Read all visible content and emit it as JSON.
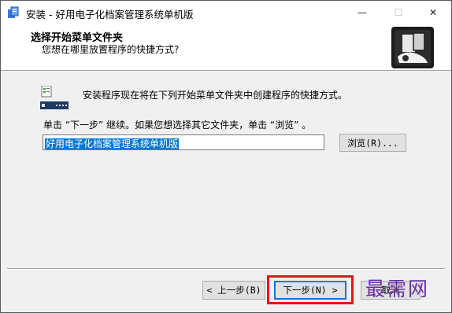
{
  "window": {
    "title": "安装 - 好用电子化档案管理系统单机版",
    "controls": {
      "minimize": "—",
      "maximize": "☐",
      "close": "✕"
    }
  },
  "header": {
    "title": "选择开始菜单文件夹",
    "subtitle": "您想在哪里放置程序的快捷方式?"
  },
  "content": {
    "info_text": "安装程序现在将在下列开始菜单文件夹中创建程序的快捷方式。",
    "instruction": "单击 “下一步” 继续。如果您想选择其它文件夹，单击 “浏览” 。",
    "folder_value": "好用电子化档案管理系统单机版",
    "browse_label": "浏览(R)..."
  },
  "footer": {
    "back_label": "< 上一步(B)",
    "next_label": "下一步(N) >",
    "cancel_label": "取消"
  },
  "watermark": "最需网",
  "colors": {
    "accent": "#0078d7",
    "highlight_border": "#e4141b",
    "watermark": "#6b2ea8"
  }
}
